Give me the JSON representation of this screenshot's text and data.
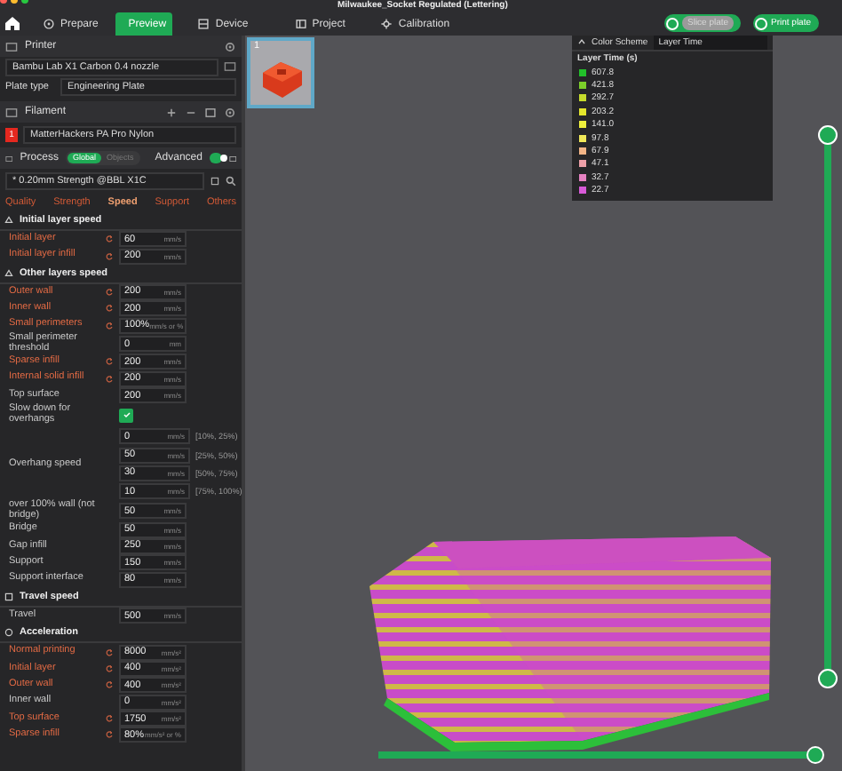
{
  "window": {
    "title": "Milwaukee_Socket Regulated (Lettering)"
  },
  "nav": [
    {
      "label": "Prepare",
      "selected": false
    },
    {
      "label": "Preview",
      "selected": true
    },
    {
      "label": "Device",
      "selected": false
    },
    {
      "label": "Project",
      "selected": false
    },
    {
      "label": "Calibration",
      "selected": false
    }
  ],
  "printer": {
    "title": "Printer",
    "preset": "Bambu Lab X1 Carbon 0.4 nozzle",
    "plate_label": "Plate type",
    "plate": "Engineering Plate"
  },
  "filament": {
    "title": "Filament",
    "slots": [
      {
        "index": "1",
        "color": "#e5281f",
        "name": "MatterHackers PA Pro Nylon"
      }
    ]
  },
  "process": {
    "title": "Process",
    "scope": [
      {
        "label": "Global",
        "selected": true
      },
      {
        "label": "Objects",
        "selected": false
      }
    ],
    "advanced_label": "Advanced",
    "advanced": true,
    "preset": "* 0.20mm Strength @BBL X1C",
    "tabs": [
      {
        "label": "Quality",
        "selected": false
      },
      {
        "label": "Strength",
        "selected": false
      },
      {
        "label": "Speed",
        "selected": true
      },
      {
        "label": "Support",
        "selected": false
      },
      {
        "label": "Others",
        "selected": false
      }
    ]
  },
  "groups": [
    {
      "title": "Initial layer speed",
      "rows": [
        {
          "kind": "field",
          "label": "Initial layer",
          "modified": true,
          "value": "60",
          "unit": "mm/s"
        },
        {
          "kind": "field",
          "label": "Initial layer infill",
          "modified": true,
          "value": "200",
          "unit": "mm/s"
        }
      ]
    },
    {
      "title": "Other layers speed",
      "rows": [
        {
          "kind": "field",
          "label": "Outer wall",
          "modified": true,
          "value": "200",
          "unit": "mm/s"
        },
        {
          "kind": "field",
          "label": "Inner wall",
          "modified": true,
          "value": "200",
          "unit": "mm/s"
        },
        {
          "kind": "field",
          "label": "Small perimeters",
          "modified": true,
          "value": "100%",
          "unit": "mm/s or %"
        },
        {
          "kind": "field",
          "label": "Small perimeter threshold",
          "modified": false,
          "value": "0",
          "unit": "mm"
        },
        {
          "kind": "field",
          "label": "Sparse infill",
          "modified": true,
          "value": "200",
          "unit": "mm/s"
        },
        {
          "kind": "field",
          "label": "Internal solid infill",
          "modified": true,
          "value": "200",
          "unit": "mm/s"
        },
        {
          "kind": "field",
          "label": "Top surface",
          "modified": false,
          "value": "200",
          "unit": "mm/s"
        },
        {
          "kind": "checkbox",
          "label": "Slow down for overhangs",
          "checked": true
        },
        {
          "kind": "multi",
          "label": "Overhang speed",
          "entries": [
            {
              "value": "0",
              "unit": "mm/s",
              "range": "[10%, 25%)"
            },
            {
              "value": "50",
              "unit": "mm/s",
              "range": "[25%, 50%)"
            },
            {
              "value": "30",
              "unit": "mm/s",
              "range": "[50%, 75%)"
            },
            {
              "value": "10",
              "unit": "mm/s",
              "range": "[75%, 100%)"
            }
          ]
        },
        {
          "kind": "field",
          "label": "over 100% wall (not bridge)",
          "modified": false,
          "value": "50",
          "unit": "mm/s"
        },
        {
          "kind": "field",
          "label": "Bridge",
          "modified": false,
          "value": "50",
          "unit": "mm/s"
        },
        {
          "kind": "field",
          "label": "Gap infill",
          "modified": false,
          "value": "250",
          "unit": "mm/s"
        },
        {
          "kind": "field",
          "label": "Support",
          "modified": false,
          "value": "150",
          "unit": "mm/s"
        },
        {
          "kind": "field",
          "label": "Support interface",
          "modified": false,
          "value": "80",
          "unit": "mm/s"
        }
      ]
    },
    {
      "title": "Travel speed",
      "rows": [
        {
          "kind": "field",
          "label": "Travel",
          "modified": false,
          "value": "500",
          "unit": "mm/s"
        }
      ]
    },
    {
      "title": "Acceleration",
      "rows": [
        {
          "kind": "field",
          "label": "Normal printing",
          "modified": true,
          "value": "8000",
          "unit": "mm/s²"
        },
        {
          "kind": "field",
          "label": "Initial layer",
          "modified": true,
          "value": "400",
          "unit": "mm/s²"
        },
        {
          "kind": "field",
          "label": "Outer wall",
          "modified": true,
          "value": "400",
          "unit": "mm/s²"
        },
        {
          "kind": "field",
          "label": "Inner wall",
          "modified": false,
          "value": "0",
          "unit": "mm/s²"
        },
        {
          "kind": "field",
          "label": "Top surface",
          "modified": true,
          "value": "1750",
          "unit": "mm/s²"
        },
        {
          "kind": "field",
          "label": "Sparse infill",
          "modified": true,
          "value": "80%",
          "unit": "mm/s² or %"
        }
      ]
    }
  ],
  "plate": {
    "number": "1",
    "selected": true
  },
  "actions": [
    {
      "label": "Slice plate",
      "disabled": true
    },
    {
      "label": "Print plate",
      "disabled": false
    }
  ],
  "legend": {
    "title": "Color Scheme",
    "scheme": "Layer Time",
    "heading": "Layer Time (s)",
    "items": [
      {
        "color": "#22c02a",
        "value": "607.8"
      },
      {
        "color": "#7ccf2a",
        "value": "421.8"
      },
      {
        "color": "#c6dc2c",
        "value": "292.7"
      },
      {
        "color": "#e4e62c",
        "value": "203.2"
      },
      {
        "color": "#eef03c",
        "value": "141.0"
      },
      {
        "color": "#f0e858",
        "value": "97.8"
      },
      {
        "color": "#f2b486",
        "value": "67.9"
      },
      {
        "color": "#eea0a8",
        "value": "47.1"
      },
      {
        "color": "#e682c2",
        "value": "32.7"
      },
      {
        "color": "#d85ad8",
        "value": "22.7"
      }
    ]
  },
  "layer_slider": {
    "level": 1
  },
  "move_slider": {
    "level": 1
  }
}
